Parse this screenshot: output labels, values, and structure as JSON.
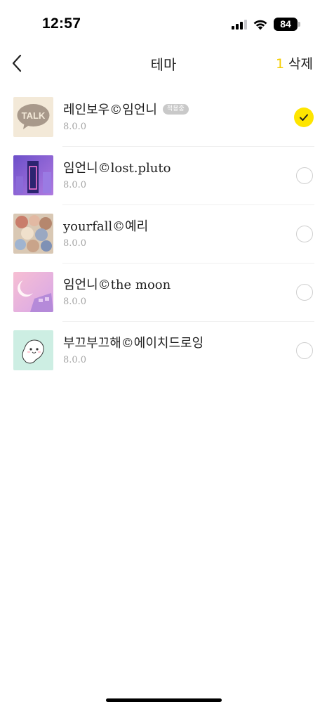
{
  "status_bar": {
    "time": "12:57",
    "battery": "84"
  },
  "header": {
    "title": "테마",
    "delete_count": "1",
    "delete_label": "삭제",
    "back_icon": "chevron-left-icon"
  },
  "themes": [
    {
      "name": "레인보우©임언니",
      "version": "8.0.0",
      "badge": "적용중",
      "selected": true,
      "thumb_label": "TALK"
    },
    {
      "name": "임언니©lost.pluto",
      "version": "8.0.0",
      "selected": false
    },
    {
      "name": "yourfall©예리",
      "version": "8.0.0",
      "selected": false
    },
    {
      "name": "임언니©the moon",
      "version": "8.0.0",
      "selected": false
    },
    {
      "name": "부끄부끄해©에이치드로잉",
      "version": "8.0.0",
      "selected": false
    }
  ],
  "colors": {
    "accent": "#fee500",
    "count": "#f5cd00"
  }
}
